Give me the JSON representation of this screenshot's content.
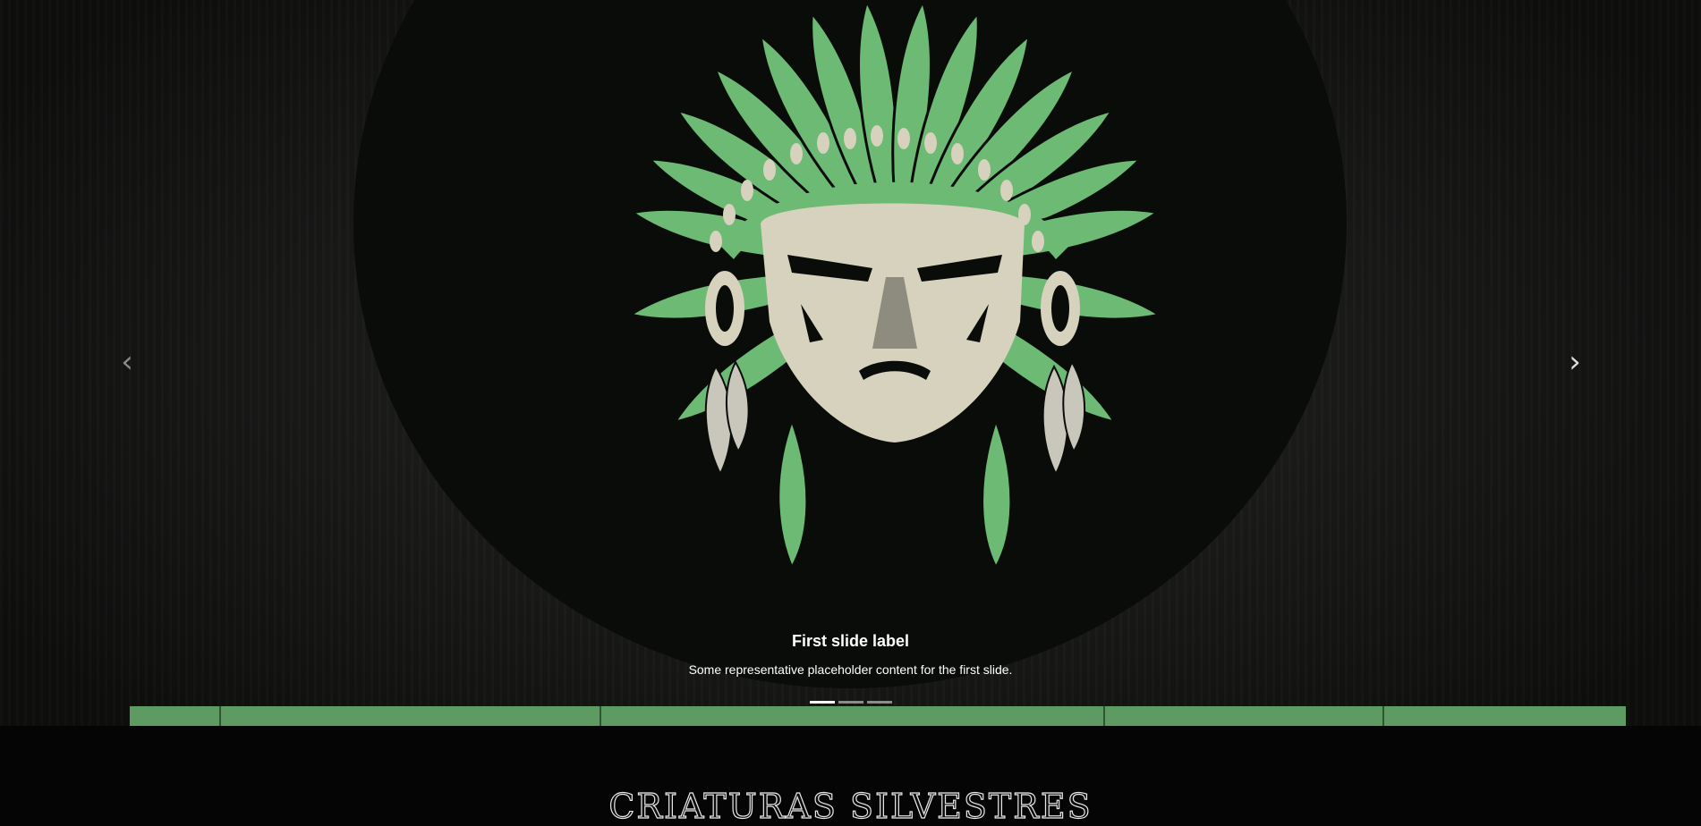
{
  "carousel": {
    "slides": [
      {
        "title": "First slide label",
        "text": "Some representative placeholder content for the first slide."
      }
    ],
    "active_index": 0,
    "indicator_count": 3,
    "prev_icon": "chevron-left-icon",
    "next_icon": "chevron-right-icon",
    "emblem_image": "native-chief-headdress-emblem"
  },
  "section": {
    "title": "Criaturas Silvestres"
  },
  "colors": {
    "page_bg": "#050505",
    "feather_green": "#6dba74",
    "face_beige": "#d6d2bd",
    "band_green": "#5e9b62"
  }
}
